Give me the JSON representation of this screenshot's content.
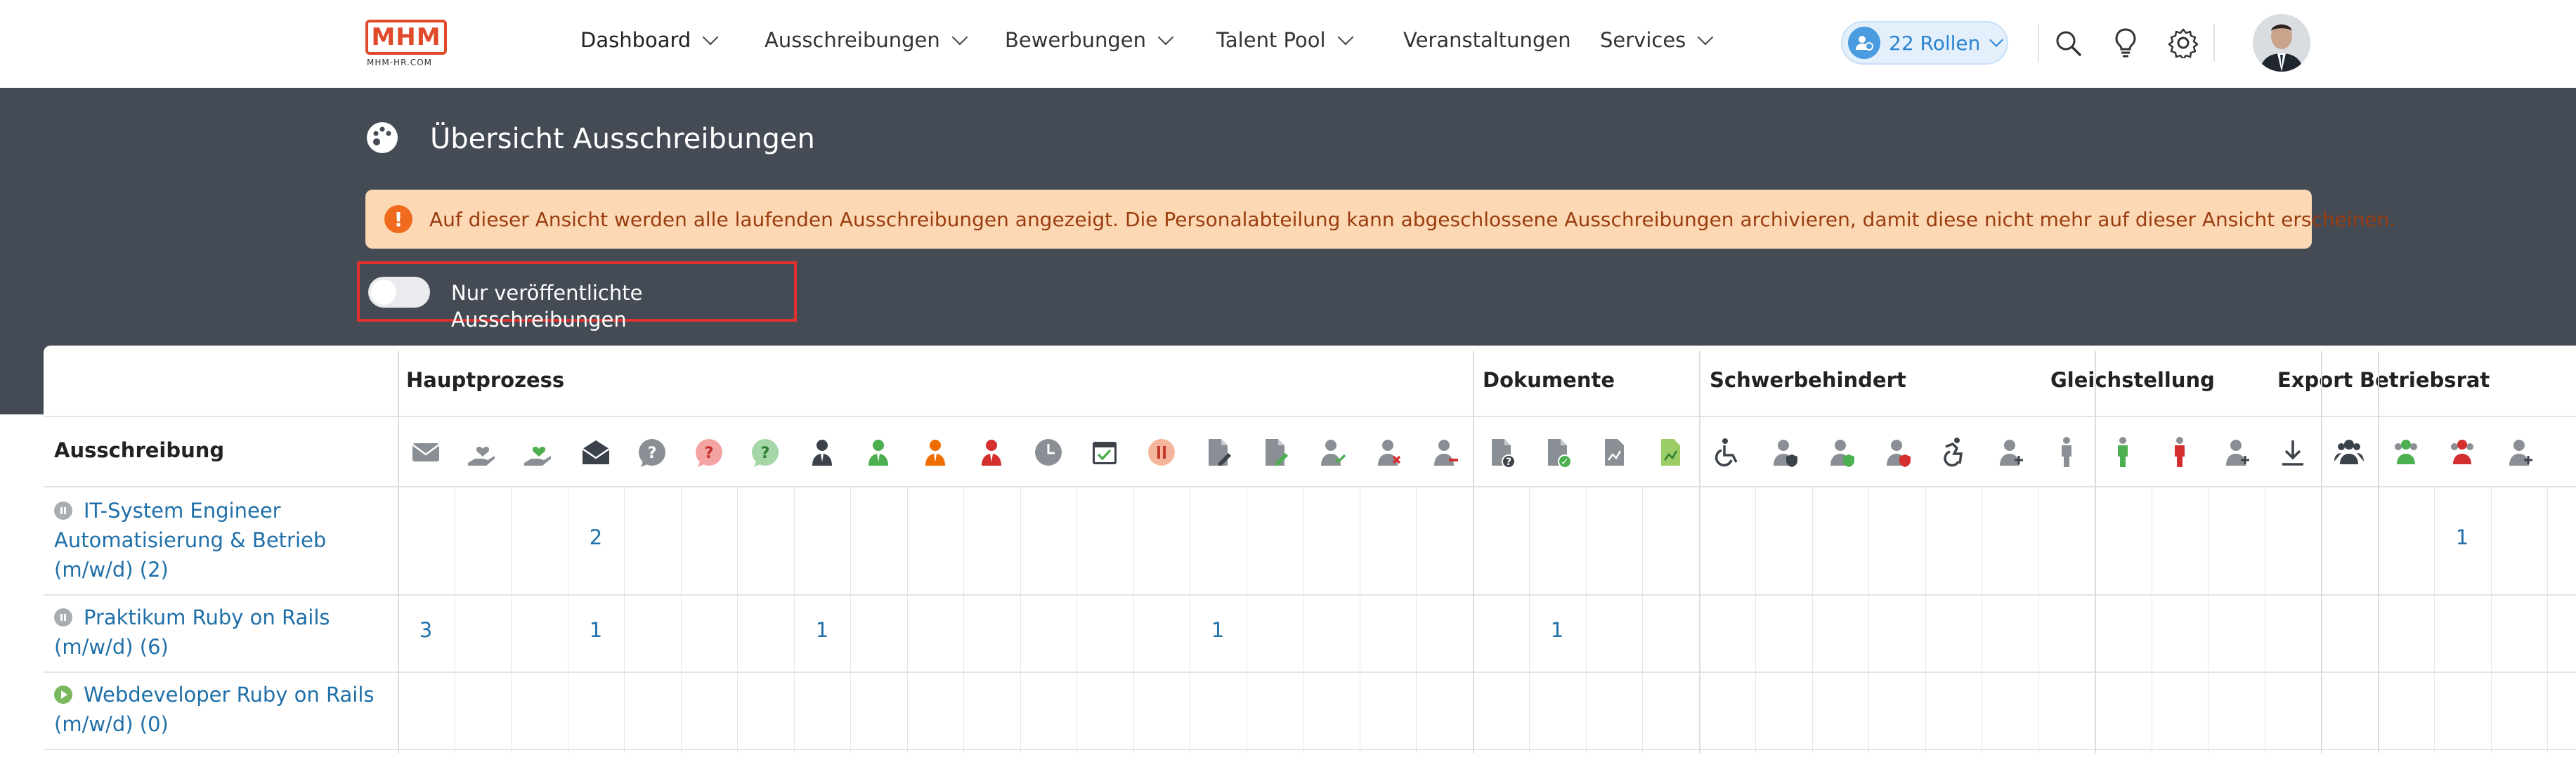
{
  "brand": {
    "logo_text": "MHM",
    "logo_sub": "MHM-HR.COM"
  },
  "nav": {
    "items": [
      {
        "label": "Dashboard",
        "dropdown": true
      },
      {
        "label": "Ausschreibungen",
        "dropdown": true
      },
      {
        "label": "Bewerbungen",
        "dropdown": true
      },
      {
        "label": "Talent Pool",
        "dropdown": true
      },
      {
        "label": "Veranstaltungen",
        "dropdown": false
      },
      {
        "label": "Services",
        "dropdown": true
      }
    ],
    "roles_label": "22 Rollen",
    "icons": [
      "search-icon",
      "lightbulb-icon",
      "gear-icon"
    ]
  },
  "page": {
    "title": "Übersicht Ausschreibungen",
    "alert": "Auf dieser Ansicht werden alle laufenden Ausschreibungen angezeigt. Die Personalabteilung kann abgeschlossene Ausschreibungen archivieren, damit diese nicht mehr auf dieser Ansicht erscheinen.",
    "toggle_label": "Nur veröffentlichte Ausschreibungen",
    "toggle_on": false
  },
  "table": {
    "first_column": "Ausschreibung",
    "groups": [
      "Hauptprozess",
      "Dokumente",
      "Schwerbehindert",
      "Gleichstellung",
      "Export",
      "Betriebsrat"
    ],
    "rows": [
      {
        "title": "IT-System Engineer Automatisierung & Betrieb (m/w/d) (2)",
        "status": "paused",
        "values": {
          "3": "2",
          "36": "1"
        }
      },
      {
        "title": "Praktikum Ruby on Rails (m/w/d) (6)",
        "status": "paused",
        "values": {
          "0": "3",
          "3": "1",
          "7": "1",
          "14": "1",
          "20": "1"
        }
      },
      {
        "title": "Webdeveloper Ruby on Rails (m/w/d) (0)",
        "status": "running",
        "values": {}
      }
    ]
  },
  "colors": {
    "band": "#444b54",
    "alert_bg": "#fcd9b4",
    "alert_text": "#9a3c0f",
    "link": "#1f6fa8",
    "highlight": "#e0312e"
  }
}
